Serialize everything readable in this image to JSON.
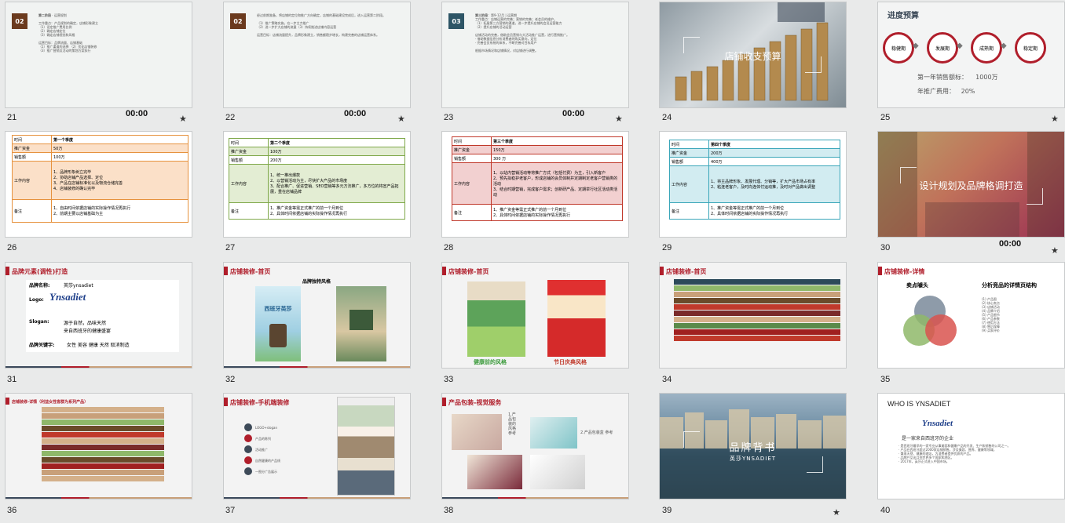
{
  "slides": [
    {
      "n": "21",
      "timer": "00:00",
      "badge": "02",
      "star": true
    },
    {
      "n": "22",
      "timer": "00:00",
      "badge": "02",
      "star": true
    },
    {
      "n": "23",
      "timer": "00:00",
      "badge": "03",
      "star": true
    },
    {
      "n": "24",
      "title": "店铺收支预算"
    },
    {
      "n": "25",
      "title": "进度预算",
      "phases": [
        "稳健期",
        "发展期",
        "成熟期",
        "稳定期"
      ],
      "line1": "第一年销售额标：    1000万",
      "line2": "年推广费用：   20%",
      "star": true
    },
    {
      "n": "26",
      "rows": [
        [
          "时间",
          "第一个季度"
        ],
        [
          "推广资金",
          "50万"
        ],
        [
          "销售额",
          "100万"
        ],
        [
          "工作内容",
          "1、品牌形象树立完毕\n2、协助店铺产品选择、定位\n3、产品在店铺标准化以及物流仓储完善\n4、店铺装修的确认完毕"
        ],
        [
          "备注",
          "1、自由时间依据店铺的实际操作情况再执行\n2、前期主要以店铺基础为主"
        ]
      ]
    },
    {
      "n": "27",
      "rows": [
        [
          "时间",
          "第二个季度"
        ],
        [
          "推广资金",
          "100万"
        ],
        [
          "销售额",
          "200万"
        ],
        [
          "工作内容",
          "1、统一推出爆款\n2、以营销活动为主，尽快扩大产品的市场度\n3、配合推广、促进营销、SEO营销等多元方法推广，多方位的将宣产品拓展，重在店铺品牌"
        ],
        [
          "备注",
          "1、推广资金等需正式推广的前一个月到位\n2、具体时间依据店铺的实际操作情况再执行"
        ]
      ]
    },
    {
      "n": "28",
      "rows": [
        [
          "时间",
          "第三个季度"
        ],
        [
          "推广资金",
          "150万"
        ],
        [
          "销售额",
          "300 万"
        ],
        [
          "工作内容",
          "1、以站内营销活动等将推广方式（包括付费）为主，引入新客户\n2、预先拟稳护老客户，形成店铺的会员体制并定期制定老客户营销类的活动\n3、结合时期营销，完成客户需求；创新研产品、定期举行社区活动类活动"
        ],
        [
          "备注",
          "1、推广资金等需正式推广的前一个月到位\n2、具体时间依据店铺的实际操作情况再执行"
        ]
      ]
    },
    {
      "n": "29",
      "rows": [
        [
          "时间",
          "第四个季度"
        ],
        [
          "推广资金",
          "200万"
        ],
        [
          "销售额",
          "400万"
        ],
        [
          "工作内容",
          "1、将主品牌形象、发展代理、分销等，扩大产品市场占有率\n2、粘连老客户，及时向连体付运动推，及时对产品做出调整"
        ],
        [
          "备注",
          "1、推广资金等需正式推广的前一个月到位\n2、具体时间依据店铺的实际操作情况再执行"
        ]
      ]
    },
    {
      "n": "30",
      "timer": "00:00",
      "title": "设计规划及品牌格调打造",
      "star": true
    },
    {
      "n": "31",
      "title": "品牌元素(调性)打造",
      "name_label": "品牌名称:",
      "name_val": "英莎ynsadiet",
      "logo_label": "Logo:",
      "logo_text": "Ynsadiet",
      "slogan_label": "Slogan:",
      "slogan1": "源于自然，品味天然",
      "slogan2": "来自西班牙的健康盛宴",
      "kw_label": "品牌关键字:",
      "kw": "女性 美容 健康 天然 取消制造"
    },
    {
      "n": "32",
      "title": "店铺装修-首页",
      "sub": "品牌独特风格",
      "poster": "西班牙英莎"
    },
    {
      "n": "33",
      "title": "店铺装修-首页",
      "cap1": "健康前的风格",
      "cap2": "节日庆典风格"
    },
    {
      "n": "34",
      "title": "店铺装修-首页"
    },
    {
      "n": "35",
      "title": "店铺装修-详情",
      "sub1": "卖点噱头",
      "sub2": "分析竞品的详情页结构"
    },
    {
      "n": "36",
      "title": "店铺装修-详情（利益女性客群为系列产品）"
    },
    {
      "n": "37",
      "title": "店铺装修-手机端装修",
      "items": [
        "LOGO+slogan",
        "产品的陈列",
        "活动推广",
        "自然健康的产品线",
        "一图分广告展示"
      ]
    },
    {
      "n": "38",
      "title": "产品包装-视觉服务",
      "note1": "1.产品包装的风格参考",
      "note2": "2.产品包装盒 参考"
    },
    {
      "n": "39",
      "title": "品牌背书",
      "sub": "英莎YNSADIET",
      "star": true
    },
    {
      "n": "40",
      "title": "WHO IS YNSADIET",
      "logo": "Ynsadiet",
      "line": "是一家来自西班牙的企业"
    }
  ]
}
